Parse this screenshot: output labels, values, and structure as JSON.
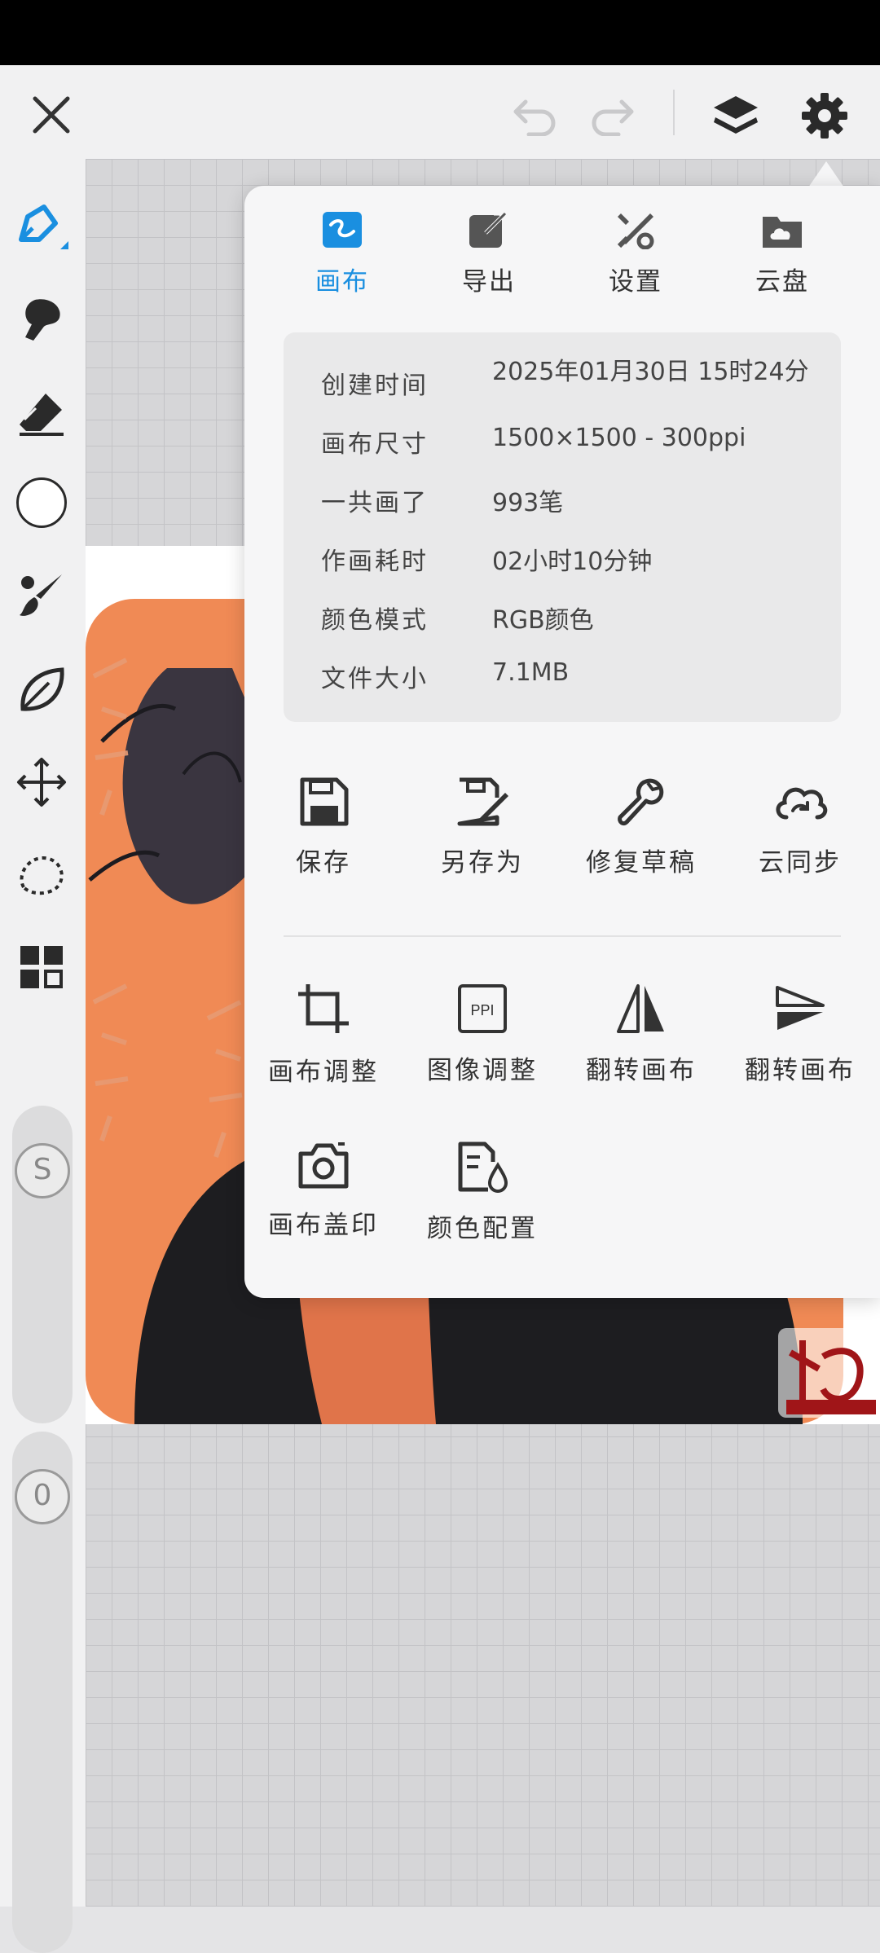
{
  "toolbar": {
    "close": "close",
    "undo": "undo",
    "redo": "redo",
    "layers": "layers",
    "settings": "settings"
  },
  "tabs": [
    {
      "label": "画布",
      "active": true,
      "icon": "canvas-icon"
    },
    {
      "label": "导出",
      "active": false,
      "icon": "export-icon"
    },
    {
      "label": "设置",
      "active": false,
      "icon": "settings-tools-icon"
    },
    {
      "label": "云盘",
      "active": false,
      "icon": "cloud-drive-icon"
    }
  ],
  "info": [
    {
      "label": "创建时间",
      "value": "2025年01月30日 15时24分"
    },
    {
      "label": "画布尺寸",
      "value": "1500×1500 - 300ppi"
    },
    {
      "label": "一共画了",
      "value": "993笔"
    },
    {
      "label": "作画耗时",
      "value": "02小时10分钟"
    },
    {
      "label": "颜色模式",
      "value": "RGB颜色"
    },
    {
      "label": "文件大小",
      "value": "7.1MB"
    }
  ],
  "actions_row1": [
    {
      "label": "保存",
      "icon": "save-icon"
    },
    {
      "label": "另存为",
      "icon": "save-as-icon"
    },
    {
      "label": "修复草稿",
      "icon": "repair-icon"
    },
    {
      "label": "云同步",
      "icon": "cloud-sync-icon"
    }
  ],
  "actions_row2": [
    {
      "label": "画布调整",
      "icon": "crop-icon"
    },
    {
      "label": "图像调整",
      "icon": "ppi-icon",
      "badge": "PPI"
    },
    {
      "label": "翻转画布",
      "icon": "flip-horizontal-icon"
    },
    {
      "label": "翻转画布",
      "icon": "flip-vertical-icon"
    }
  ],
  "actions_row3": [
    {
      "label": "画布盖印",
      "icon": "camera-icon"
    },
    {
      "label": "颜色配置",
      "icon": "color-config-icon"
    }
  ],
  "sliders": {
    "size_label": "S",
    "opacity_label": "0"
  },
  "colors": {
    "accent": "#1a8fe0",
    "orange": "#f08a55",
    "panel": "#f6f6f7"
  }
}
